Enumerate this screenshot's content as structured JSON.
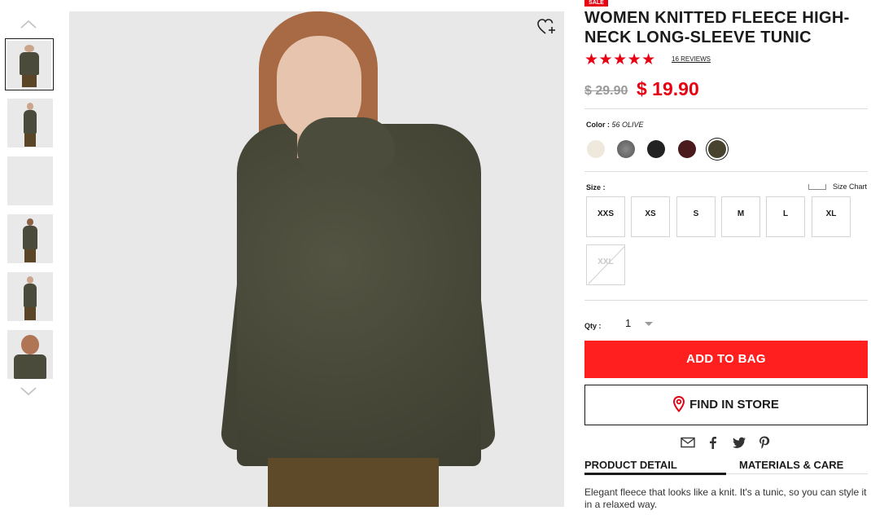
{
  "gallery": {
    "up_icon": "chevron-up-icon",
    "down_icon": "chevron-down-icon",
    "thumbnails": [
      "model-front",
      "model-full",
      "fabric-closeup",
      "model-back",
      "model-side",
      "model-closeup"
    ],
    "wishlist_icon": "heart-plus-icon"
  },
  "product": {
    "badge": "SALE",
    "title": "WOMEN KNITTED FLEECE HIGH-NECK LONG-SLEEVE TUNIC",
    "rating_stars": "★★★★★",
    "rating": 5,
    "reviews": "16 REVIEWS",
    "old_price": "$ 29.90",
    "price": "$ 19.90",
    "price_color": "#e60012"
  },
  "color": {
    "label": "Color : ",
    "selected": "56 OLIVE",
    "swatches": [
      {
        "name": "off-white",
        "hex": "#efe8dc"
      },
      {
        "name": "gray",
        "hex": "#6e6e6e"
      },
      {
        "name": "black",
        "hex": "#222222"
      },
      {
        "name": "wine",
        "hex": "#4a1a1c"
      },
      {
        "name": "olive",
        "hex": "#48432f",
        "selected": true
      }
    ]
  },
  "size": {
    "label": "Size :",
    "chart_link": "Size Chart",
    "options": [
      "XXS",
      "XS",
      "S",
      "M",
      "L",
      "XL",
      "XXL"
    ],
    "unavailable": [
      "XXL"
    ]
  },
  "quantity": {
    "label": "Qty :",
    "value": "1"
  },
  "actions": {
    "add_to_bag": "ADD TO BAG",
    "find_in_store": "FIND IN STORE",
    "accent": "#ff1f1f"
  },
  "share": [
    "mail-icon",
    "facebook-icon",
    "twitter-icon",
    "pinterest-icon"
  ],
  "tabs": {
    "detail": "PRODUCT DETAIL",
    "materials": "MATERIALS & CARE",
    "active": "PRODUCT DETAIL"
  },
  "description": "Elegant fleece that looks like a knit. It's a tunic, so you can style it in a relaxed way."
}
